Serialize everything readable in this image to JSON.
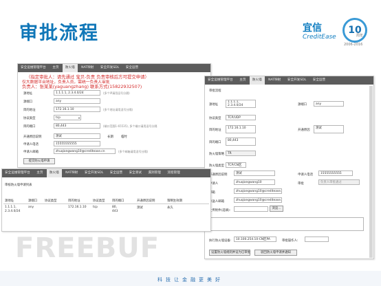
{
  "title": "审批流程",
  "logo": {
    "cn": "宜信",
    "en": "CreditEase",
    "ten": "10",
    "yr": "2006-2016",
    "years": "周年"
  },
  "watermark": "FREEBUF",
  "slogan": "科技让金融更美好",
  "nav": {
    "app": "安全运维管理平台",
    "items": [
      "主页",
      "防火墙",
      "NAT映射",
      "安全开发SDL",
      "安全运营",
      "安全测试",
      "漏洞管理",
      "流程管理"
    ]
  },
  "panel1": {
    "warning_1": "（指定审批人：请先通过 宝贝-负责 负责审核后方可提交申请）",
    "warning_2": "仅大数据平台地址，负责人员，需统一负责人审批",
    "warning_3": "负责人：张某某(yaguangzhang) 联系方式(15822932507)",
    "fields": [
      {
        "label": "源地址",
        "value": "1.1.1.1, 2.3.4.0/24",
        "note": "(多个IP请用逗号分隔)"
      },
      {
        "label": "源端口",
        "value": "any",
        "note": ""
      },
      {
        "label": "目的地址",
        "value": "172.16.1.10",
        "note": "(多个地址请用逗号分隔)"
      },
      {
        "label": "协议类型",
        "value": "tcp",
        "note": ""
      },
      {
        "label": "目的端口",
        "value": "80,443",
        "note": "(端口范围1-65535), 多个端口请用逗号分隔"
      },
      {
        "label": "开通原因说明",
        "value": "测试",
        "note": ""
      },
      {
        "label": "申请人电话",
        "value": "15555555555",
        "note": ""
      },
      {
        "label": "申请人邮箱",
        "value": "zhuqiangwang10@creditease.cn",
        "note": "(多个邮箱请用逗号分隔)"
      }
    ],
    "radio_label": "长期",
    "radio_label_2": "临时",
    "submit_button": "提交防火墙申请"
  },
  "panel2": {
    "heading": "审批流程",
    "fields_left": [
      {
        "label": "源地址",
        "value": "1.1.1.1,\n2.3.4.0/24"
      },
      {
        "label": "协议类型",
        "value": "TCP/UDP"
      },
      {
        "label": "目的地址",
        "value": "172.16.1.10"
      },
      {
        "label": "目的端口",
        "value": "80,443"
      },
      {
        "label": "防火墙策略",
        "value": "TR"
      },
      {
        "label": "防火墙类型",
        "value": "TCP/CN区"
      }
    ],
    "fields_right": [
      {
        "label": "源端口",
        "value": "any"
      },
      {
        "label": "开通原因",
        "value": "测试"
      },
      {
        "label": "申请人电话",
        "value": "15555555555"
      },
      {
        "label": "审批",
        "value": "负责人审批通过"
      }
    ],
    "person_rows": [
      {
        "label": "开通原因说明",
        "value": "测试"
      },
      {
        "label": "申请人",
        "value": "zhuqiangwang10"
      },
      {
        "label": "邮箱",
        "value": "zhuqiangwang10@creditease.cn"
      },
      {
        "label": "抄送人邮箱",
        "value": "zhuqiangwang10@creditease.cn"
      }
    ],
    "upload_label": "上传附件(选填):",
    "browse_button": "浏览...",
    "exec_label": "执行防火墙设备:",
    "exec_value": "10.100.254.10-CN区PA",
    "exec_user_label": "审批操作人:",
    "approve_button": "设置防火墙规则并设为已审批",
    "reject_button": "驳回防火墙申请并通知"
  },
  "panel3": {
    "heading": "审核防火墙申请列表",
    "headers": [
      "源地址",
      "源端口",
      "协议类型",
      "目的地址",
      "协议类型",
      "目的端口",
      "开通原因说明",
      "策略生效期"
    ],
    "row": [
      "1.1.1.1,\n2.3.4.0/24",
      "any",
      "",
      "172.16.1.10",
      "tcp",
      "80,\n443",
      "测试",
      "永久"
    ]
  }
}
